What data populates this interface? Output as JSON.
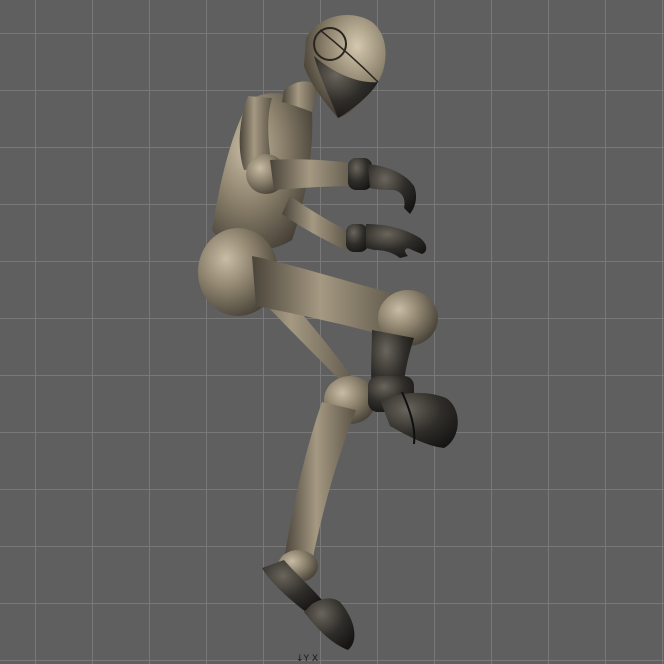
{
  "viewport": {
    "background_color": "#5f5f5f",
    "grid_color": "#787878",
    "body_color": "#9a8f7c",
    "body_shadow_color": "#4a453b",
    "joint_color": "#2e2c28"
  },
  "axis_label": "↓Y X"
}
